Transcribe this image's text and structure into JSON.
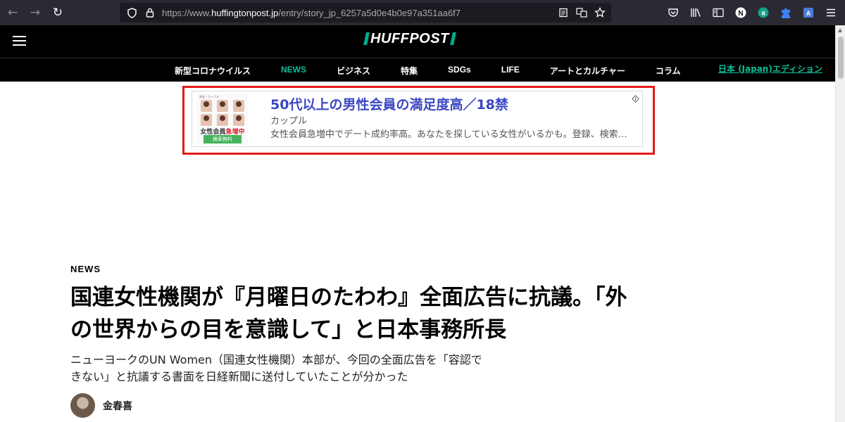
{
  "browser": {
    "url_prefix": "https://www.",
    "url_domain": "huffingtonpost.jp",
    "url_path": "/entry/story_jp_6257a5d0e4b0e97a351aa6f7",
    "icons": [
      "back-icon",
      "forward-icon",
      "reload-icon",
      "shield-icon",
      "lock-icon",
      "reader-view-icon",
      "translate-icon",
      "bookmark-star-icon",
      "pocket-icon",
      "library-icon",
      "sidebar-icon",
      "extension-n-icon",
      "extension-a-icon",
      "extension-puzzle-icon",
      "extension-translate-icon",
      "menu-icon"
    ]
  },
  "site": {
    "logo": "HUFFPOST",
    "nav": [
      "新型コロナウイルス",
      "NEWS",
      "ビジネス",
      "特集",
      "SDGs",
      "LIFE",
      "アートとカルチャー",
      "コラム"
    ],
    "active_nav": "NEWS",
    "edition": "日本 (Japan)エディション"
  },
  "ad": {
    "title": "50代以上の男性会員の満足度高／18禁",
    "subtitle": "カップル",
    "description": "女性会員急増中でデート成約率高。あなたを探している女性がいるかも。登録、検索…",
    "thumb_caption_prefix": "女性会員",
    "thumb_caption_highlight": "急増中",
    "thumb_button": "検索無料",
    "thumb_header": "独身・カップル"
  },
  "article": {
    "kicker": "NEWS",
    "headline_line1": "国連女性機関が『月曜日のたわわ』全面広告に抗議。「外",
    "headline_line2": "の世界からの目を意識して」と日本事務所長",
    "dek_line1": "ニューヨークのUN Women（国連女性機関）本部が、今回の全面広告を「容認で",
    "dek_line2": "きない」と抗議する書面を日経新聞に送付していたことが分かった",
    "author": "金春喜"
  },
  "colors": {
    "accent": "#0dbe98",
    "ad_title": "#3a46c2",
    "ad_outline": "#e21b1b"
  }
}
